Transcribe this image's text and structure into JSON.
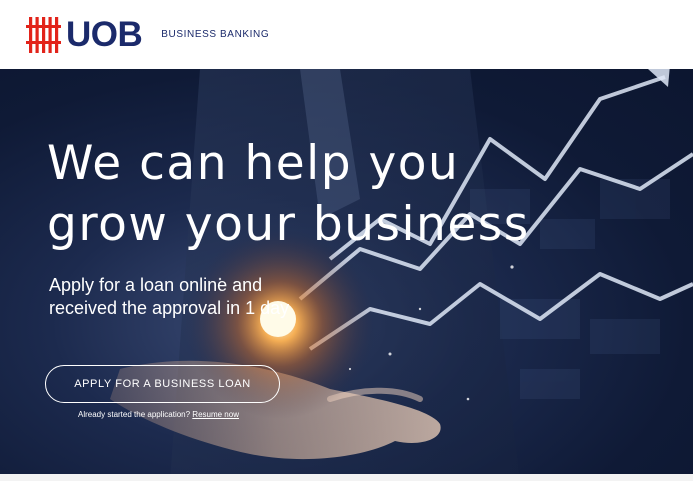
{
  "header": {
    "logo_text": "UOB",
    "tagline": "BUSINESS BANKING",
    "logo_color": "#1b2a6b",
    "mark_color": "#e2231a"
  },
  "hero": {
    "headline_line1": "We can help you",
    "headline_line2": "grow your business",
    "subhead_line1": "Apply for a loan online and",
    "subhead_line2": "received the approval in 1 day",
    "cta_label": "APPLY FOR A BUSINESS LOAN",
    "resume_prompt": "Already started the application?",
    "resume_link": "Resume now"
  },
  "icons": {
    "brand_mark": "uob-logo-icon"
  }
}
